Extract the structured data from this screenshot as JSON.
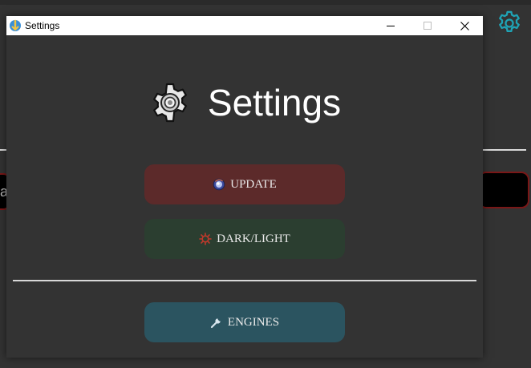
{
  "window": {
    "title": "Settings",
    "controls": {
      "minimize": "minimize",
      "maximize": "maximize",
      "close": "close"
    }
  },
  "settings": {
    "heading": "Settings",
    "buttons": {
      "update": "UPDATE",
      "darklight": "DARK/LIGHT",
      "engines": "ENGINES"
    }
  },
  "background": {
    "input_fragment": "a"
  },
  "icons": {
    "app": "app-icon",
    "heading": "gear-icon",
    "update": "update-orb-icon",
    "darklight": "sun-icon",
    "engines": "wrench-icon",
    "background_settings": "gear-icon"
  },
  "colors": {
    "window_bg": "#333333",
    "update_button": "#5c2a2a",
    "darklight_button": "#2b3e30",
    "engines_button": "#2b5460",
    "accent_gear": "#1fa3b5",
    "input_border": "#7a1717"
  }
}
